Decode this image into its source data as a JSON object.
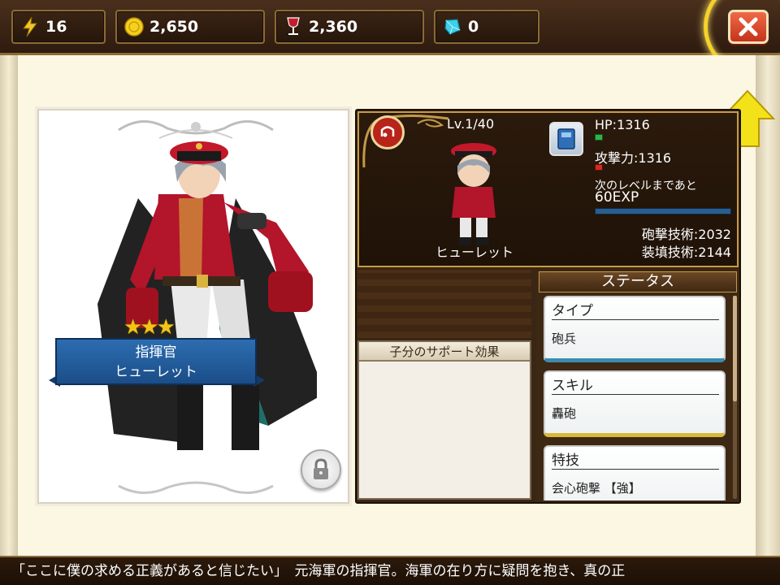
{
  "resources": {
    "stamina": "16",
    "gold": "2,650",
    "wine": "2,360",
    "gems": "0"
  },
  "icons": {
    "stamina": "lightning-icon",
    "gold": "coin-icon",
    "wine": "wine-glass-icon",
    "gems": "gem-icon",
    "close": "close-icon",
    "lock": "lock-icon",
    "arrow": "up-arrow-icon"
  },
  "character": {
    "stars": "★★★",
    "rank": "指揮官",
    "name": "ヒューレット",
    "level": "Lv.1/40",
    "chibi_name": "ヒューレット"
  },
  "stats": {
    "hp": "HP:1316",
    "attack": "攻撃力:1316",
    "next_label": "次のレベルまであと",
    "exp": "60EXP",
    "artillery": "砲撃技術:2032",
    "loading": "装填技術:2144"
  },
  "support": {
    "title": "子分のサポート効果"
  },
  "status": {
    "header": "ステータス",
    "items": [
      {
        "title": "タイプ",
        "value": "砲兵"
      },
      {
        "title": "スキル",
        "value": "轟砲"
      },
      {
        "title": "特技",
        "value": "会心砲撃 【強】"
      }
    ]
  },
  "ticker": {
    "text": "「ここに僕の求める正義があると信じたい」　元海軍の指揮官。海軍の在り方に疑問を抱き、真の正"
  },
  "colors": {
    "accent_gold": "#f6d22a",
    "close_red": "#d8442a",
    "banner_blue": "#1b4d88",
    "hp_green": "#2fb34a",
    "atk_red": "#d52a20"
  }
}
